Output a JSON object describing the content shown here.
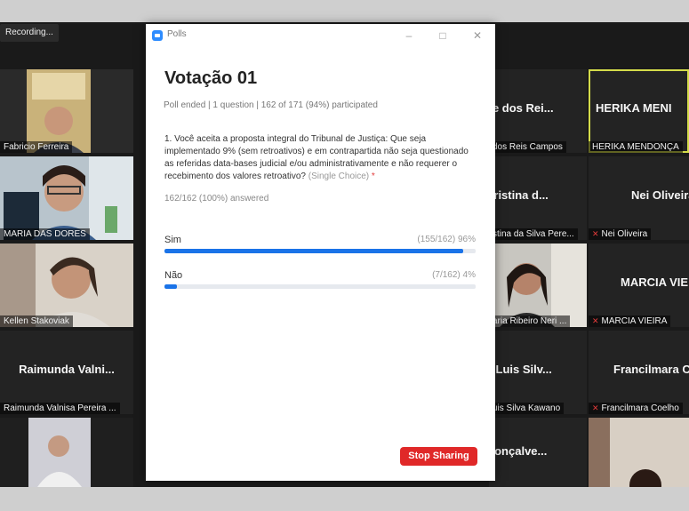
{
  "recording": "Recording...",
  "poll": {
    "window_title": "Polls",
    "minimize_icon": "minimize-icon",
    "maximize_icon": "maximize-icon",
    "close_icon": "close-icon",
    "title": "Votação 01",
    "meta": "Poll ended | 1 question | 162 of 171 (94%) participated",
    "question": "1. Você aceita a proposta integral do Tribunal de Justiça: Que seja implementado 9% (sem retroativos) e em contrapartida não seja questionado as referidas data-bases judicial e/ou administrativamente e não requerer o recebimento dos valores retroativo?",
    "question_type": "(Single Choice)",
    "required_mark": "*",
    "answered": "162/162 (100%) answered",
    "options": [
      {
        "label": "Sim",
        "count": "(155/162) 96%",
        "fraction": 0.96
      },
      {
        "label": "Não",
        "count": "(7/162) 4%",
        "fraction": 0.04
      }
    ],
    "stop_button": "Stop Sharing",
    "accent": "#1a73e8",
    "stop_color": "#e02828"
  },
  "participants_left": [
    {
      "name": "Fabricio Ferreira"
    },
    {
      "name": "MARIA DAS DORES"
    },
    {
      "name": "Kellen Stakoviak"
    },
    {
      "big": "Raimunda Valni...",
      "name": "Raimunda Valnisa Pereira ..."
    },
    {
      "name": ""
    }
  ],
  "participants_mid": [
    {
      "big": "ne dos Rei...",
      "name": "dos Reis Campos"
    },
    {
      "big": "Cristina d...",
      "name": "stina da Silva Pere..."
    },
    {
      "name": "aria Ribeiro Neri ..."
    },
    {
      "big": "o Luis Silv...",
      "name": "uis Silva Kawano"
    },
    {
      "big": "Gonçalve...",
      "name": ""
    }
  ],
  "participants_right": [
    {
      "big": "HERIKA MENI",
      "name": "HERIKA MENDONÇA"
    },
    {
      "big": "Nei Oliveira",
      "name": "Nei Oliveira"
    },
    {
      "big": "MARCIA VIEIR",
      "name": "MARCIA VIEIRA"
    },
    {
      "big": "Francilmara C",
      "name": "Francilmara Coelho"
    },
    {
      "name": ""
    }
  ]
}
